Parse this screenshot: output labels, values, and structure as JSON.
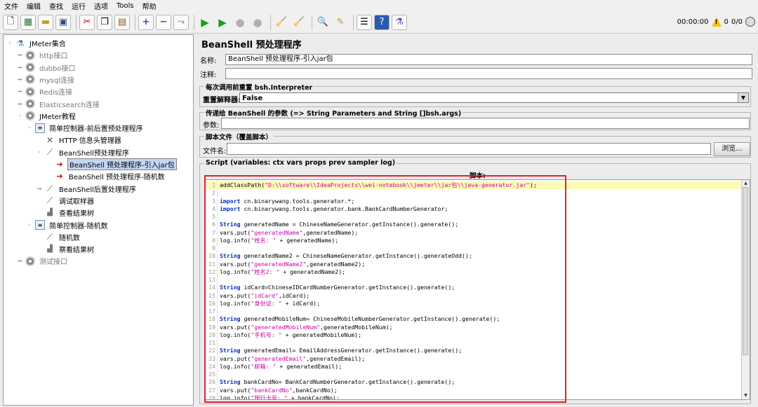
{
  "menu": [
    "文件",
    "编辑",
    "查找",
    "运行",
    "选项",
    "Tools",
    "帮助"
  ],
  "toolbar": {
    "timer": "00:00:00",
    "warning_count": "0",
    "thread_count": "0/0"
  },
  "tree": [
    {
      "label": "JMeter集合",
      "icon": "flask-icon",
      "exp": "minus",
      "level": 0,
      "grey": false
    },
    {
      "label": "http接口",
      "icon": "gear-icon",
      "exp": "plus",
      "level": 1,
      "grey": true
    },
    {
      "label": "dubbo接口",
      "icon": "gear-icon",
      "exp": "plus",
      "level": 1,
      "grey": true
    },
    {
      "label": "mysql连接",
      "icon": "gear-icon",
      "exp": "plus",
      "level": 1,
      "grey": true
    },
    {
      "label": "Redis连接",
      "icon": "gear-icon",
      "exp": "plus",
      "level": 1,
      "grey": true
    },
    {
      "label": "Elasticsearch连接",
      "icon": "gear-icon",
      "exp": "plus",
      "level": 1,
      "grey": true
    },
    {
      "label": "JMeter教程",
      "icon": "gear-icon",
      "exp": "minus",
      "level": 1,
      "grey": false
    },
    {
      "label": "简单控制器-前后置预处理程序",
      "icon": "controller-icon",
      "exp": "minus",
      "level": 2,
      "grey": false
    },
    {
      "label": "HTTP 信息头管理器",
      "icon": "header-manager-icon",
      "exp": "",
      "level": 3,
      "grey": false
    },
    {
      "label": "BeanShell预处理程序",
      "icon": "wrench-icon",
      "exp": "minus",
      "level": 3,
      "grey": false
    },
    {
      "label": "BeanShell 预处理程序-引入jar包",
      "icon": "preprocessor-icon",
      "exp": "",
      "level": 4,
      "grey": false,
      "selected": true
    },
    {
      "label": "BeanShell 预处理程序-随机数",
      "icon": "preprocessor-icon",
      "exp": "",
      "level": 4,
      "grey": false
    },
    {
      "label": "BeanShell后置处理程序",
      "icon": "wrench-icon",
      "exp": "plus",
      "level": 3,
      "grey": false
    },
    {
      "label": "调试取样器",
      "icon": "wrench-icon",
      "exp": "",
      "level": 3,
      "grey": false
    },
    {
      "label": "查看结果树",
      "icon": "chart-icon",
      "exp": "",
      "level": 3,
      "grey": false
    },
    {
      "label": "简单控制器-随机数",
      "icon": "controller-icon",
      "exp": "minus",
      "level": 2,
      "grey": false
    },
    {
      "label": "随机数",
      "icon": "wrench-icon",
      "exp": "",
      "level": 3,
      "grey": false
    },
    {
      "label": "察看结果树",
      "icon": "chart-icon",
      "exp": "",
      "level": 3,
      "grey": false
    },
    {
      "label": "测试接口",
      "icon": "gear-icon",
      "exp": "plus",
      "level": 1,
      "grey": true
    }
  ],
  "panel": {
    "title": "BeanShell 预处理程序",
    "name_label": "名称:",
    "name_value": "BeanShell 预处理程序-引入jar包",
    "comment_label": "注释:",
    "comment_value": "",
    "reset_group_title": "每次调用前重置 bsh.Interpreter",
    "reset_label": "重置解释器:",
    "reset_value": "False",
    "params_group_title": "传递给 BeanShell 的参数 (=> String Parameters and String []bsh.args)",
    "params_label": "参数:",
    "params_value": "",
    "file_group_title": "脚本文件（覆盖脚本）",
    "file_label": "文件名:",
    "file_value": "",
    "browse_label": "浏览...",
    "script_group_title": "Script (variables: ctx vars props prev sampler log)",
    "script_heading": "脚本:"
  },
  "code": [
    [
      [
        "n",
        "addClassPath("
      ],
      [
        "s",
        "\"D:\\\\software\\\\IdeaProjects\\\\wei-notebook\\\\jmeter\\\\jar包\\\\java-generator.jar\""
      ],
      [
        "n",
        ");"
      ]
    ],
    [],
    [
      [
        "k",
        "import"
      ],
      [
        "n",
        " cn.binarywang.tools.generator.*;"
      ]
    ],
    [
      [
        "k",
        "import"
      ],
      [
        "n",
        " cn.binarywang.tools.generator.bank.BankCardNumberGenerator;"
      ]
    ],
    [],
    [
      [
        "k",
        "String"
      ],
      [
        "n",
        " generatedName = ChineseNameGenerator.getInstance().generate();"
      ]
    ],
    [
      [
        "n",
        "vars.put("
      ],
      [
        "s",
        "\"generatedName\""
      ],
      [
        "n",
        ",generatedName);"
      ]
    ],
    [
      [
        "n",
        "log.info("
      ],
      [
        "s",
        "\"姓名: \""
      ],
      [
        "n",
        " + generatedName);"
      ]
    ],
    [],
    [
      [
        "k",
        "String"
      ],
      [
        "n",
        " generatedName2 = ChineseNameGenerator.getInstance().generateOdd();"
      ]
    ],
    [
      [
        "n",
        "vars.put("
      ],
      [
        "s",
        "\"generatedName2\""
      ],
      [
        "n",
        ",generatedName2);"
      ]
    ],
    [
      [
        "n",
        "log.info("
      ],
      [
        "s",
        "\"姓名2: \""
      ],
      [
        "n",
        " + generatedName2);"
      ]
    ],
    [],
    [
      [
        "k",
        "String"
      ],
      [
        "n",
        " idCard=ChineseIDCardNumberGenerator.getInstance().generate();"
      ]
    ],
    [
      [
        "n",
        "vars.put("
      ],
      [
        "s",
        "\"idCard\""
      ],
      [
        "n",
        ",idCard);"
      ]
    ],
    [
      [
        "n",
        "log.info("
      ],
      [
        "s",
        "\"身份证: \""
      ],
      [
        "n",
        " + idCard);"
      ]
    ],
    [],
    [
      [
        "k",
        "String"
      ],
      [
        "n",
        " generatedMobileNum= ChineseMobileNumberGenerator.getInstance().generate();"
      ]
    ],
    [
      [
        "n",
        "vars.put("
      ],
      [
        "s",
        "\"generatedMobileNum\""
      ],
      [
        "n",
        ",generatedMobileNum);"
      ]
    ],
    [
      [
        "n",
        "log.info("
      ],
      [
        "s",
        "\"手机号: \""
      ],
      [
        "n",
        " + generatedMobileNum);"
      ]
    ],
    [],
    [
      [
        "k",
        "String"
      ],
      [
        "n",
        " generatedEmail= EmailAddressGenerator.getInstance().generate();"
      ]
    ],
    [
      [
        "n",
        "vars.put("
      ],
      [
        "s",
        "\"generatedEmail\""
      ],
      [
        "n",
        ",generatedEmail);"
      ]
    ],
    [
      [
        "n",
        "log.info("
      ],
      [
        "s",
        "\"邮箱: \""
      ],
      [
        "n",
        " + generatedEmail);"
      ]
    ],
    [],
    [
      [
        "k",
        "String"
      ],
      [
        "n",
        " bankCardNo= BankCardNumberGenerator.getInstance().generate();"
      ]
    ],
    [
      [
        "n",
        "vars.put("
      ],
      [
        "s",
        "\"bankCardNo\""
      ],
      [
        "n",
        ",bankCardNo);"
      ]
    ],
    [
      [
        "n",
        "log.info("
      ],
      [
        "s",
        "\"银行卡号: \""
      ],
      [
        "n",
        " + bankCardNo);"
      ]
    ]
  ]
}
